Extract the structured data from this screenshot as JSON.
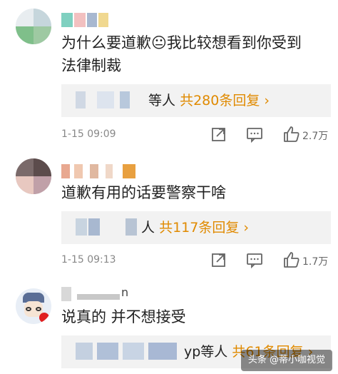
{
  "comments": [
    {
      "text_line1": "为什么要道歉😐我比较想看到你受到",
      "text_line2": "法律制裁",
      "reply_suffix": "等人",
      "reply_count": "共280条回复 ›",
      "date": "1-15 09:09",
      "likes": "2.7万"
    },
    {
      "text_line1": "道歉有用的话要警察干啥",
      "reply_suffix": "人",
      "reply_count": "共117条回复 ›",
      "date": "1-15 09:13",
      "likes": "1.7万"
    },
    {
      "text_line1": "说真的 并不想接受",
      "name_tail": "n",
      "reply_suffix": "yp等人",
      "reply_count": "共61条回复 ›"
    }
  ],
  "watermark": "头条 @蒂小咖视觉",
  "icons": [
    "share-icon",
    "comment-icon",
    "thumbs-up-icon"
  ]
}
